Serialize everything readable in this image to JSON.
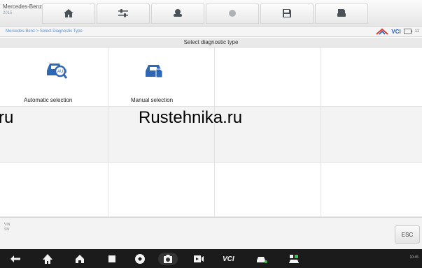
{
  "header": {
    "vehicle_make": "Mercedes-Benz",
    "vehicle_year": "2015",
    "tabs": [
      {
        "name": "home-icon"
      },
      {
        "name": "settings-sliders-icon"
      },
      {
        "name": "vehicle-icon"
      },
      {
        "name": "record-icon"
      },
      {
        "name": "save-icon"
      },
      {
        "name": "print-icon"
      }
    ]
  },
  "breadcrumb": {
    "text": "Mercedes-Benz > Select Diagnostic Type"
  },
  "status": {
    "vci_label": "VCI",
    "battery_text": "11"
  },
  "page": {
    "title": "Select diagnostic type"
  },
  "options": [
    {
      "label": "Automatic selection",
      "icon": "auto-scan-car-icon"
    },
    {
      "label": "Manual selection",
      "icon": "manual-select-car-icon"
    }
  ],
  "watermarks": [
    "ru",
    "Rustehnika.ru"
  ],
  "footer": {
    "line1": "VIN",
    "line2": "SN",
    "esc_label": "ESC"
  },
  "navbar": {
    "icons": [
      "back-icon",
      "autel-home-icon",
      "home-icon",
      "recent-apps-icon",
      "browser-icon",
      "camera-icon",
      "screen-record-icon",
      "vci-icon",
      "vehicle-menu-icon",
      "vehicle-connect-icon"
    ],
    "vci_text": "VCI",
    "system_status": "10:45"
  },
  "colors": {
    "accent_blue": "#1f64c8",
    "accent_red": "#e03a2d",
    "vci_green": "#3cc04c",
    "icon_blue": "#2e67b4"
  }
}
